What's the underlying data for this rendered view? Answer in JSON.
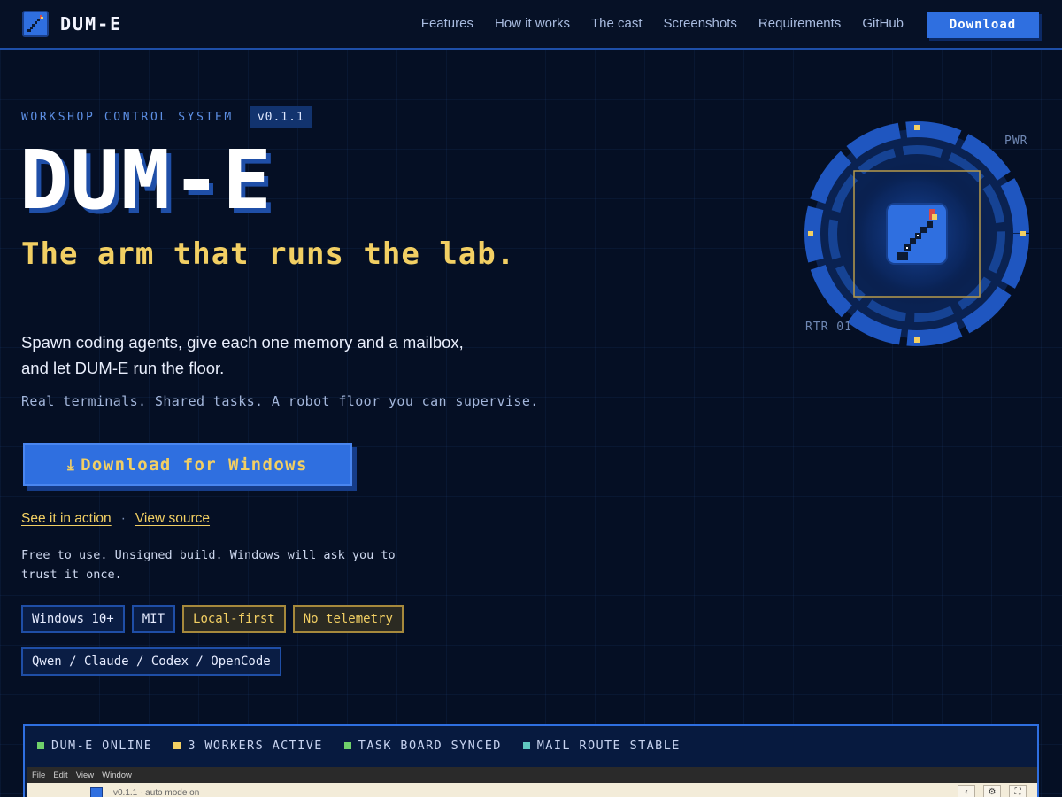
{
  "brand": {
    "name": "DUM-E",
    "accent": "#2f6fe0",
    "gold": "#f2cf63",
    "background": "#050f24"
  },
  "nav": {
    "links": [
      "Features",
      "How it works",
      "The cast",
      "Screenshots",
      "Requirements",
      "GitHub"
    ],
    "download_label": "Download"
  },
  "hero": {
    "eyebrow": "WORKSHOP CONTROL SYSTEM",
    "version": "v0.1.1",
    "title": "DUM-E",
    "subtitle": "The arm that runs the lab.",
    "lead_line1": "Spawn coding agents, give each one memory and a mailbox,",
    "lead_line2": "and let DUM-E run the floor.",
    "tagline": "Real terminals. Shared tasks. A robot floor you can supervise.",
    "cta_icon": "download-icon",
    "cta_label": "Download for Windows",
    "link_action": "See it in action",
    "link_separator": "·",
    "link_source": "View source",
    "note": "Free to use. Unsigned build. Windows will ask you to trust it once.",
    "badges": [
      {
        "label": "Windows 10+",
        "style": "blue"
      },
      {
        "label": "MIT",
        "style": "blue"
      },
      {
        "label": "Local-first",
        "style": "gold"
      },
      {
        "label": "No telemetry",
        "style": "gold"
      },
      {
        "label": "Qwen / Claude / Codex / OpenCode",
        "style": "blue"
      }
    ]
  },
  "dial": {
    "label_top": "PWR",
    "label_bottom": "RTR 01",
    "icon": "robot-arm-icon"
  },
  "status": {
    "items": [
      {
        "label": "DUM-E ONLINE",
        "color": "#6fd06a"
      },
      {
        "label": "3 WORKERS ACTIVE",
        "color": "#f2cf63"
      },
      {
        "label": "TASK BOARD SYNCED",
        "color": "#6fd06a"
      },
      {
        "label": "MAIL ROUTE STABLE",
        "color": "#5fc7c0"
      }
    ]
  },
  "screenshot": {
    "menu": [
      "File",
      "Edit",
      "View",
      "Window"
    ],
    "title": "v0.1.1 · auto mode on",
    "buttons": [
      "‹",
      "⚙",
      "⛶"
    ]
  }
}
